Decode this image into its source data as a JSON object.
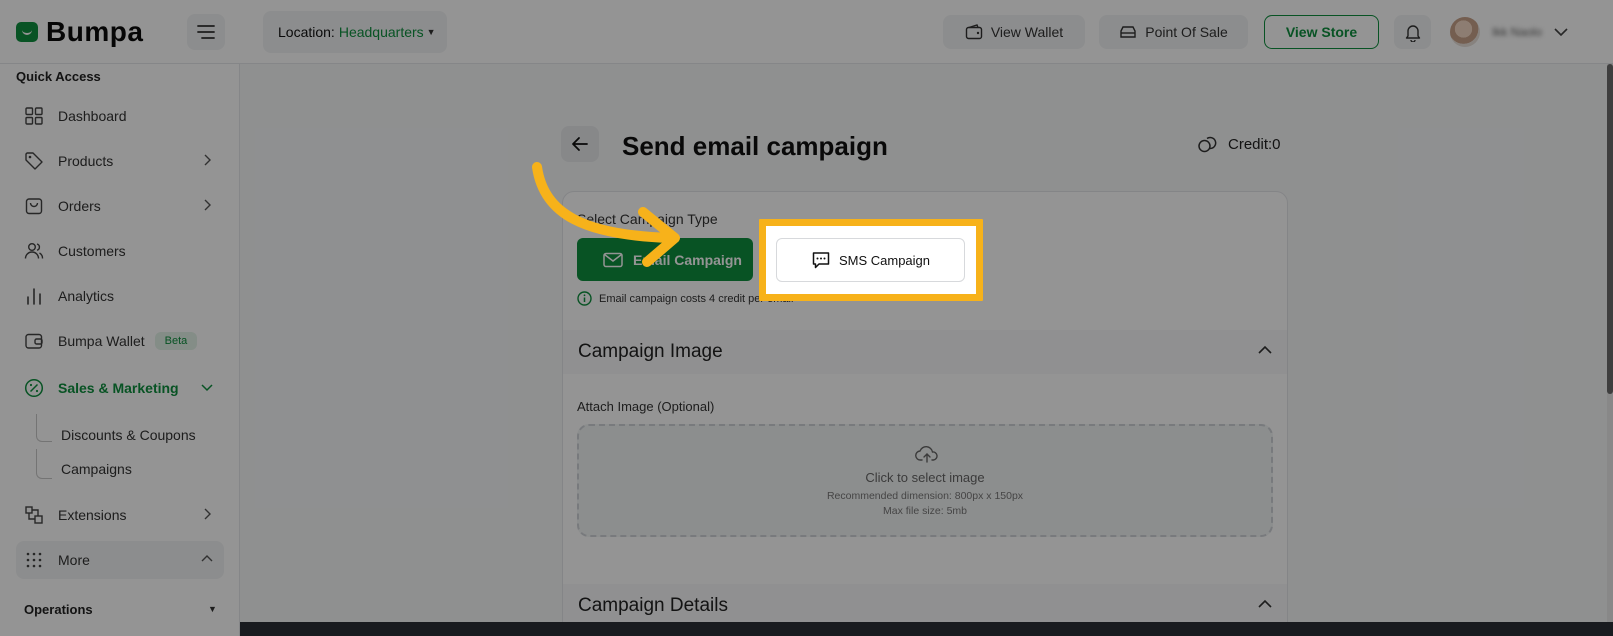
{
  "brand": {
    "name": "Bumpa",
    "color": "#0e8f3e"
  },
  "header": {
    "location_label": "Location:",
    "location_value": "Headquarters",
    "view_wallet": "View Wallet",
    "point_of_sale": "Point Of Sale",
    "view_store": "View Store",
    "user_name": "Ikk Naolo"
  },
  "sidebar": {
    "quick_access_title": "Quick Access",
    "items": [
      {
        "label": "Dashboard",
        "icon": "grid-icon"
      },
      {
        "label": "Products",
        "icon": "tag-icon"
      },
      {
        "label": "Orders",
        "icon": "bag-icon"
      },
      {
        "label": "Customers",
        "icon": "users-icon"
      },
      {
        "label": "Analytics",
        "icon": "bar-chart-icon"
      },
      {
        "label": "Bumpa Wallet",
        "icon": "wallet-icon",
        "badge": "Beta"
      },
      {
        "label": "Sales & Marketing",
        "icon": "percent-icon"
      },
      {
        "label": "Extensions",
        "icon": "puzzle-icon"
      },
      {
        "label": "More",
        "icon": "dots-grid-icon"
      }
    ],
    "sub_items": [
      "Discounts & Coupons",
      "Campaigns"
    ],
    "operations_title": "Operations"
  },
  "page": {
    "title": "Send email campaign",
    "credit": "Credit:0",
    "select_label": "Select Campaign Type",
    "email_campaign": "Email Campaign",
    "sms_campaign": "SMS Campaign",
    "info_text": "Email campaign costs 4 credit per email",
    "campaign_image_title": "Campaign Image",
    "attach_label": "Attach Image (Optional)",
    "upload_main": "Click to select image",
    "upload_dim": "Recommended dimension: 800px x 150px",
    "upload_size": "Max file size: 5mb",
    "campaign_details_title": "Campaign Details"
  },
  "overlay": {
    "highlight_color": "#f7b21a",
    "arrow_color": "#f7b21a"
  }
}
